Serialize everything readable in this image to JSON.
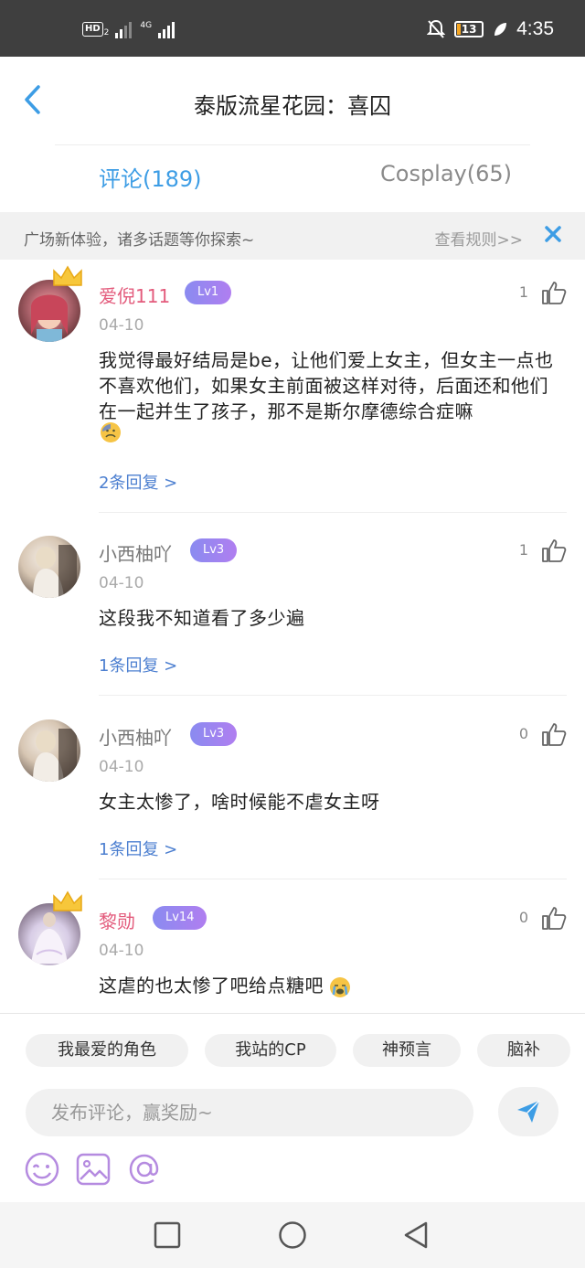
{
  "status_bar": {
    "network": "HD",
    "sim": "2",
    "signal_label": "4G",
    "battery": "13",
    "time": "4:35"
  },
  "header": {
    "title": "泰版流星花园：喜囚"
  },
  "tabs": [
    {
      "label": "评论(189)",
      "active": true
    },
    {
      "label": "Cosplay(65)",
      "active": false
    }
  ],
  "notice": {
    "text": "广场新体验，诸多话题等你探索~",
    "rule_link": "查看规则>>"
  },
  "comments": [
    {
      "user": "爱倪111",
      "level": "Lv1",
      "date": "04-10",
      "likes": "1",
      "text": "我觉得最好结局是be，让他们爱上女主，但女主一点也不喜欢他们，如果女主前面被这样对待，后面还和他们在一起并生了孩子，那不是斯尔摩德综合症嘛",
      "replies": "2条回复 >"
    },
    {
      "user": "小西柚吖",
      "level": "Lv3",
      "date": "04-10",
      "likes": "1",
      "text": "这段我不知道看了多少遍",
      "replies": "1条回复 >"
    },
    {
      "user": "小西柚吖",
      "level": "Lv3",
      "date": "04-10",
      "likes": "0",
      "text": "女主太惨了，啥时候能不虐女主呀",
      "replies": "1条回复 >"
    },
    {
      "user": "黎勋",
      "level": "Lv14",
      "date": "04-10",
      "likes": "0",
      "text": "这虐的也太惨了吧给点糖吧"
    }
  ],
  "topic_chips": [
    "我最爱的角色",
    "我站的CP",
    "神预言",
    "脑补"
  ],
  "comment_input": {
    "placeholder": "发布评论，赢奖励~"
  },
  "colors": {
    "accent": "#3d9de5",
    "username_pink": "#e35b7c",
    "reply_link": "#4c7fd0",
    "level_badge": "#9b85f0"
  }
}
